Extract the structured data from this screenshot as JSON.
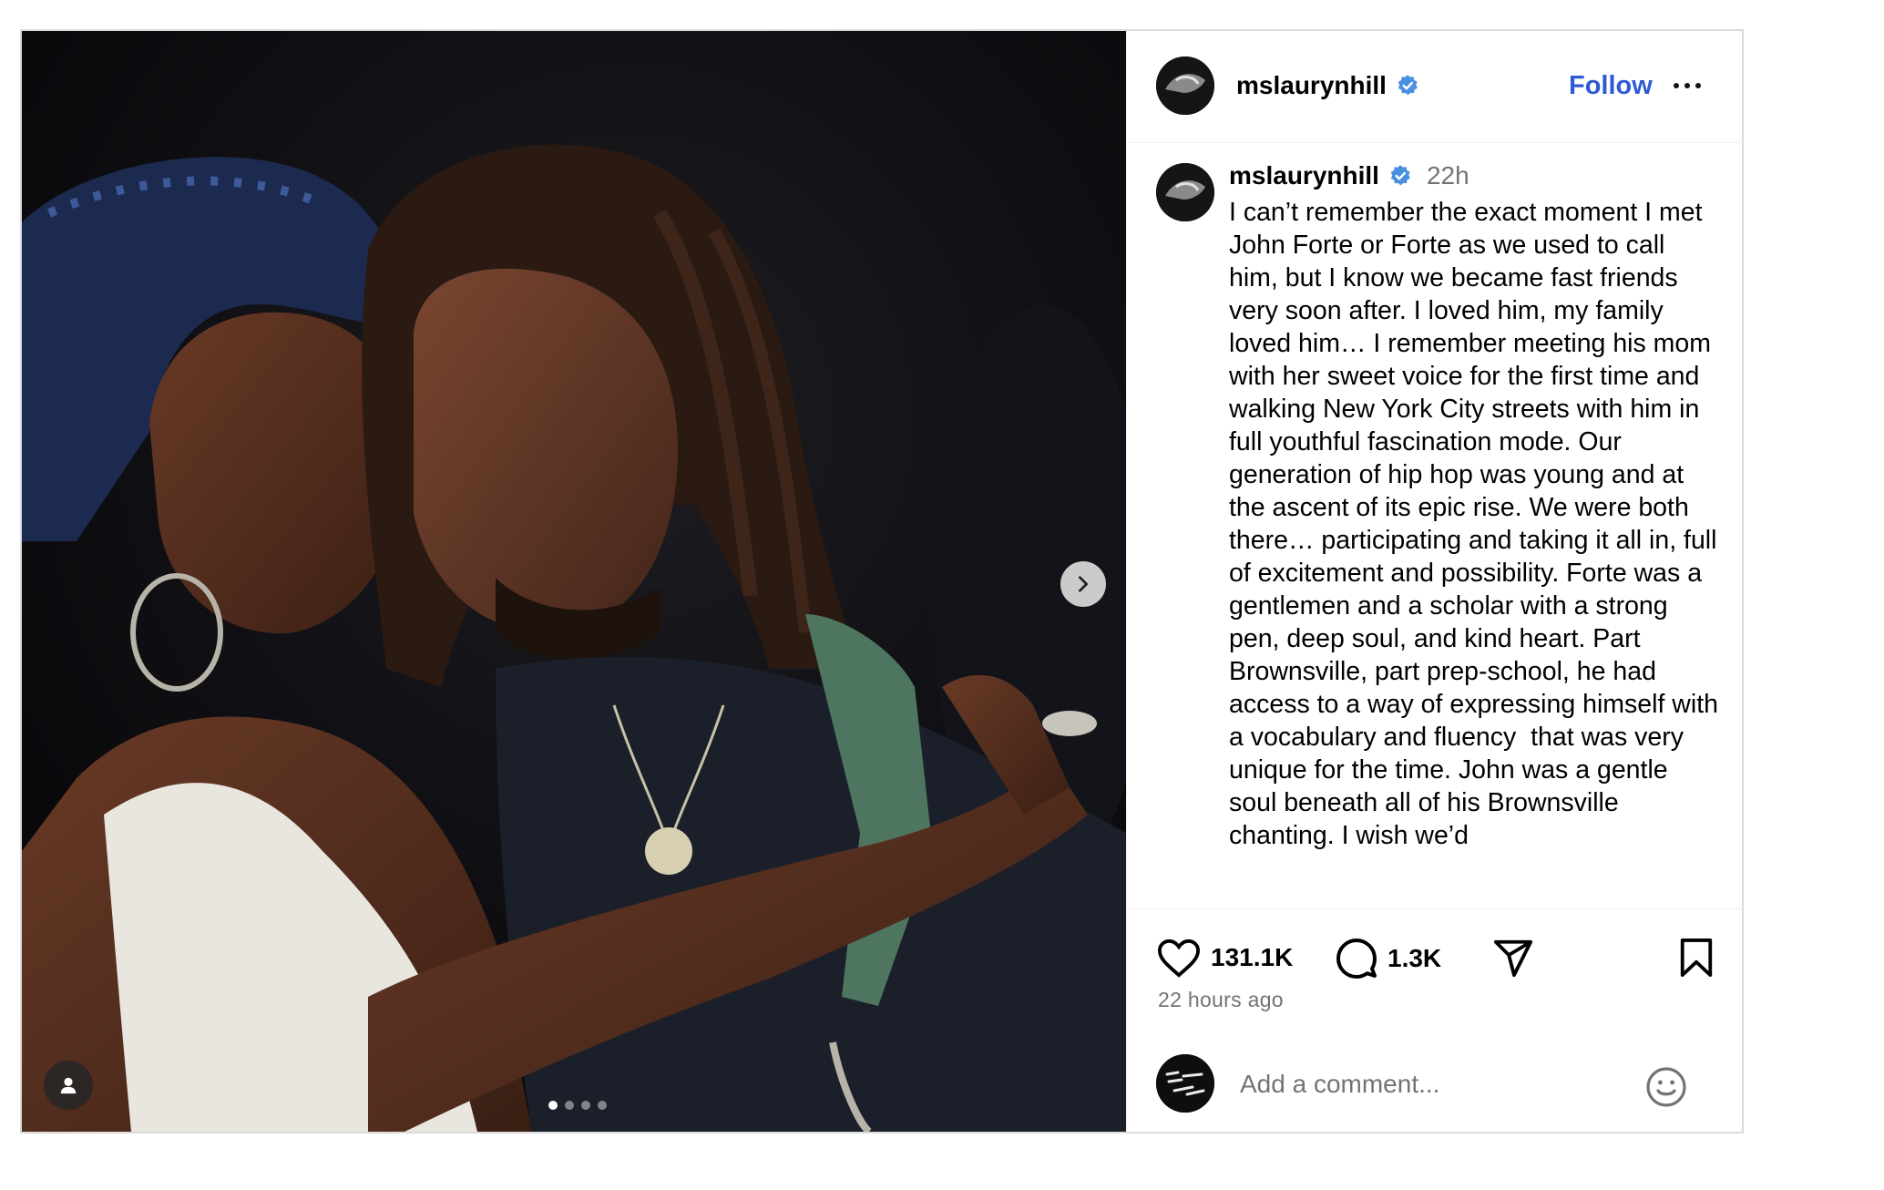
{
  "post": {
    "media": {
      "image_alt": "Photo of two people embracing",
      "slide_count": 4,
      "active_slide": 0
    },
    "header": {
      "username": "mslaurynhill",
      "verified": true,
      "follow_label": "Follow"
    },
    "caption": {
      "username": "mslaurynhill",
      "timestamp": "22h",
      "text": "I can’t remember the exact moment I met John Forte or Forte as we used to call him, but I know we became fast friends very soon after. I loved him, my family loved him… I remember meeting his mom with her sweet voice for the first time and walking New York City streets with him in full youthful fascination mode. Our generation of hip hop was young and at the ascent of its epic rise. We were both there… participating and taking it all in, full of excitement and possibility. Forte was a gentlemen and a scholar with a strong pen, deep soul, and kind heart. Part Brownsville, part prep-school, he had access to a way of expressing himself with a vocabulary and fluency  that was very unique for the time. John was a gentle soul beneath all of his Brownsville chanting. I wish we’d"
    },
    "actions": {
      "like_count": "131.1K",
      "comment_count": "1.3K",
      "time_ago": "22 hours ago"
    },
    "comment": {
      "placeholder": "Add a comment..."
    },
    "colors": {
      "accent": "#2e5bd3",
      "verified": "#4a90e2",
      "muted": "#737373",
      "border": "#dbdbdb"
    },
    "icons": [
      "chevron-right-icon",
      "user-tag-icon",
      "verified-badge-icon",
      "more-options-icon",
      "heart-icon",
      "comment-icon",
      "share-icon",
      "bookmark-icon",
      "emoji-icon"
    ]
  }
}
